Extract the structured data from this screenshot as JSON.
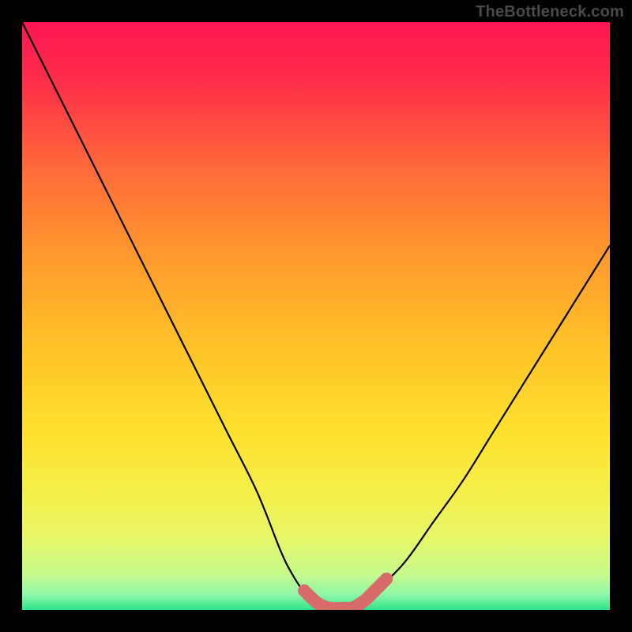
{
  "watermark": "TheBottleneck.com",
  "chart_data": {
    "type": "line",
    "title": "",
    "xlabel": "",
    "ylabel": "",
    "xlim": [
      0,
      100
    ],
    "ylim": [
      0,
      100
    ],
    "series": [
      {
        "name": "bottleneck-curve",
        "x": [
          0,
          5,
          10,
          15,
          20,
          25,
          30,
          35,
          40,
          44,
          46,
          48,
          50,
          52,
          54,
          56,
          58,
          60,
          65,
          70,
          75,
          80,
          85,
          90,
          95,
          100
        ],
        "y": [
          100,
          90,
          80,
          70,
          60,
          50,
          40,
          30,
          20,
          10,
          6,
          3,
          1,
          0,
          0,
          0,
          1,
          3,
          8,
          15,
          22,
          30,
          38,
          46,
          54,
          62
        ]
      }
    ],
    "gradient_stops": [
      {
        "offset": 0.0,
        "color": "#ff1552"
      },
      {
        "offset": 0.1,
        "color": "#ff2e4a"
      },
      {
        "offset": 0.25,
        "color": "#ff6a3a"
      },
      {
        "offset": 0.4,
        "color": "#ff9a2e"
      },
      {
        "offset": 0.55,
        "color": "#ffc228"
      },
      {
        "offset": 0.7,
        "color": "#ffe22e"
      },
      {
        "offset": 0.8,
        "color": "#f4ef4a"
      },
      {
        "offset": 0.88,
        "color": "#e6f76a"
      },
      {
        "offset": 0.94,
        "color": "#c6f98c"
      },
      {
        "offset": 0.975,
        "color": "#8df7a8"
      },
      {
        "offset": 1.0,
        "color": "#2ee38a"
      }
    ],
    "highlight_band": {
      "x_start": 48,
      "x_end": 62,
      "color": "#d86a6a"
    }
  }
}
